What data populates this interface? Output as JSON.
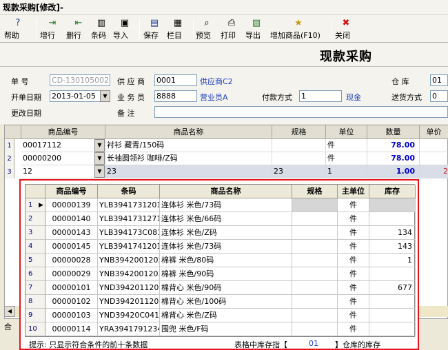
{
  "window": {
    "title": "现款采购[修改]-"
  },
  "toolbar": {
    "items": [
      {
        "label": "帮助",
        "icon": "help-icon",
        "glyph": "?"
      },
      {
        "label": "增行",
        "icon": "insert-row-icon",
        "glyph": "⇥"
      },
      {
        "label": "删行",
        "icon": "delete-row-icon",
        "glyph": "⇤"
      },
      {
        "label": "条码",
        "icon": "barcode-icon",
        "glyph": "▥"
      },
      {
        "label": "导入",
        "icon": "import-icon",
        "glyph": "▣"
      },
      {
        "label": "保存",
        "icon": "save-icon",
        "glyph": "▤"
      },
      {
        "label": "栏目",
        "icon": "columns-icon",
        "glyph": "▦"
      },
      {
        "label": "预览",
        "icon": "preview-icon",
        "glyph": "⌕"
      },
      {
        "label": "打印",
        "icon": "print-icon",
        "glyph": "⎙"
      },
      {
        "label": "导出",
        "icon": "export-icon",
        "glyph": "▨"
      },
      {
        "label": "增加商品(F10)",
        "icon": "add-product-icon",
        "glyph": "★"
      },
      {
        "label": "关闭",
        "icon": "close-icon",
        "glyph": "✖"
      }
    ]
  },
  "form": {
    "heading": "现款采购",
    "doc_no_label": "单    号",
    "doc_no_value": "CD-130105002",
    "supplier_label": "供 应 商",
    "supplier_code": "0001",
    "supplier_name": "供应商C2",
    "warehouse_label": "仓    库",
    "warehouse_value": "01",
    "date_label": "开单日期",
    "date_value": "2013-01-05",
    "clerk_label": "业 务 员",
    "clerk_code": "8888",
    "clerk_name": "营业员A",
    "pay_label": "付款方式",
    "pay_code": "1",
    "pay_name": "现金",
    "delivery_label": "送货方式",
    "delivery_value": "0",
    "modified_label": "更改日期",
    "note_label": "备    注",
    "note_value": ""
  },
  "grid": {
    "headers": [
      "商品编号",
      "商品名称",
      "规格",
      "单位",
      "数量",
      "单价"
    ],
    "rows": [
      {
        "n": "1",
        "code": "00017112",
        "name": "衬衫   藏青/150码",
        "spec": "",
        "unit": "件",
        "qty": "78.00",
        "price": ""
      },
      {
        "n": "2",
        "code": "00000200",
        "name": "长袖圆领衫  咖啡/Z码",
        "spec": "",
        "unit": "件",
        "qty": "78.00",
        "price": ""
      },
      {
        "n": "3",
        "code": "12",
        "name": "23",
        "spec": "23",
        "unit": "1",
        "qty": "1.00",
        "price": "2"
      }
    ],
    "footer_label": "合"
  },
  "popup": {
    "headers": [
      "商品编号",
      "条码",
      "商品名称",
      "规格",
      "主单位",
      "库存"
    ],
    "rows": [
      {
        "n": "1",
        "code": "00000139",
        "barcode": "YLB3941731201",
        "name": "连体衫  米色/73码",
        "spec": "",
        "unit": "件",
        "stock": ""
      },
      {
        "n": "2",
        "code": "00000140",
        "barcode": "YLB3941731271",
        "name": "连体衫  米色/66码",
        "spec": "",
        "unit": "件",
        "stock": ""
      },
      {
        "n": "3",
        "code": "00000143",
        "barcode": "YLB394173C08122",
        "name": "连体衫  米色/Z码",
        "spec": "",
        "unit": "件",
        "stock": "134"
      },
      {
        "n": "4",
        "code": "00000145",
        "barcode": "YLB3941741201",
        "name": "连体衫  米色/73码",
        "spec": "",
        "unit": "件",
        "stock": "143"
      },
      {
        "n": "5",
        "code": "00000028",
        "barcode": "YNB3942001202",
        "name": "棉裤  米色/80码",
        "spec": "",
        "unit": "件",
        "stock": "1"
      },
      {
        "n": "6",
        "code": "00000029",
        "barcode": "YNB3942001203",
        "name": "棉裤  米色/90码",
        "spec": "",
        "unit": "件",
        "stock": ""
      },
      {
        "n": "7",
        "code": "00000101",
        "barcode": "YND3942011203",
        "name": "棉背心  米色/90码",
        "spec": "",
        "unit": "件",
        "stock": "677"
      },
      {
        "n": "8",
        "code": "00000102",
        "barcode": "YND3942011205",
        "name": "棉背心  米色/100码",
        "spec": "",
        "unit": "件",
        "stock": ""
      },
      {
        "n": "9",
        "code": "00000103",
        "barcode": "YND39420C04122",
        "name": "棉背心  米色/Z码",
        "spec": "",
        "unit": "件",
        "stock": ""
      },
      {
        "n": "10",
        "code": "00000114",
        "barcode": "YRA3941791234",
        "name": "围兜  米色/F码",
        "spec": "",
        "unit": "件",
        "stock": ""
      }
    ],
    "hint_left": "提示: 只显示符合条件的前十条数据",
    "hint_mid": "表格中库存指【",
    "hint_wh": "01",
    "hint_right": "】仓库的库存"
  },
  "colors": {
    "accent_blue": "#1d3fbf",
    "popup_border": "#e8121a",
    "qty_blue": "#0000c8"
  }
}
